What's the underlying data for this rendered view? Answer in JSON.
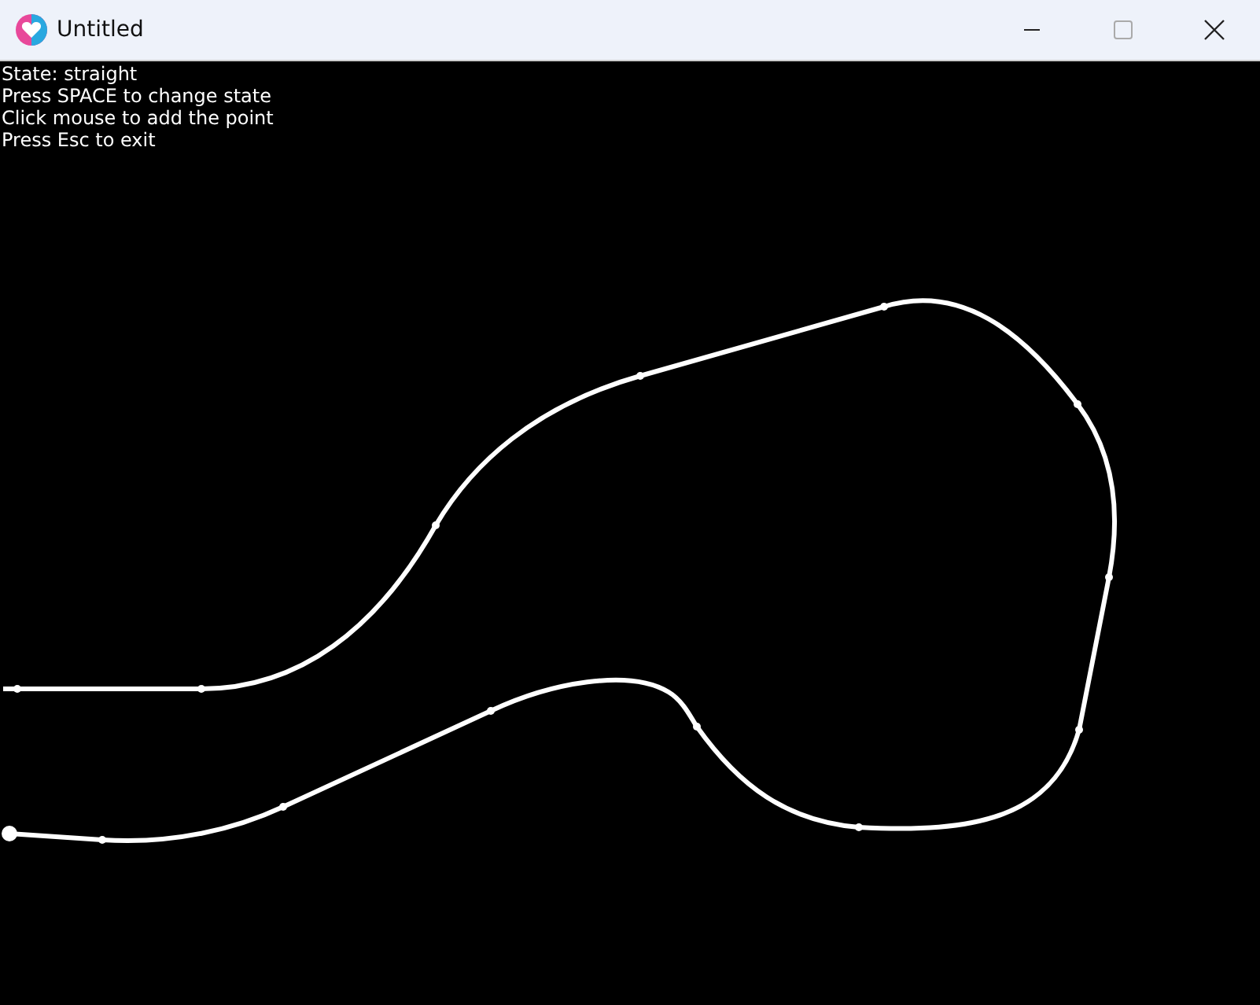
{
  "window": {
    "title": "Untitled"
  },
  "info_lines": [
    "State: straight",
    "Press SPACE to change state",
    "Click mouse to add the point",
    "Press Esc to exit"
  ]
}
